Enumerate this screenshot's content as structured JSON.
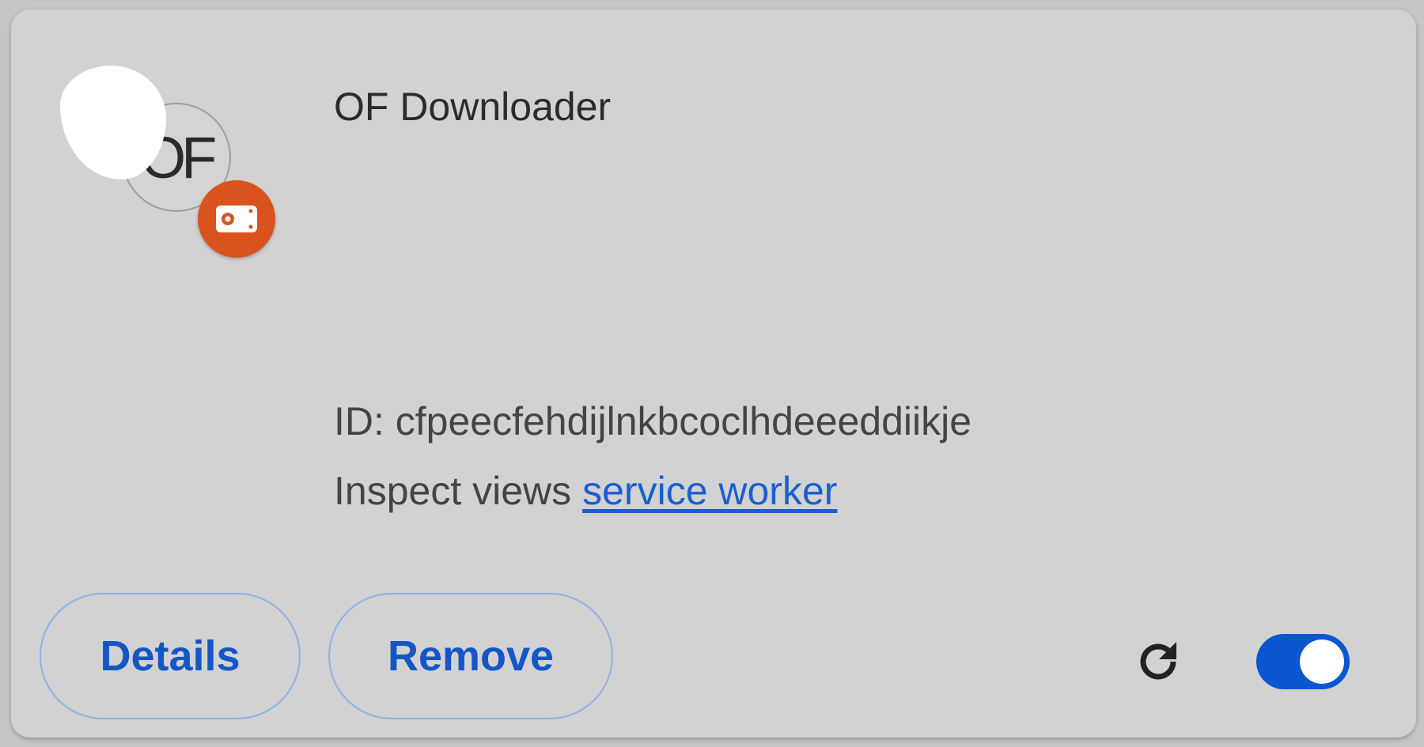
{
  "extension": {
    "logo_text": "OF",
    "name": "OF Downloader",
    "id_line": "ID: cfpeecfehdijlnkbcoclhdeeeddiikje",
    "inspect_label": "Inspect views",
    "inspect_link": "service worker"
  },
  "buttons": {
    "details": "Details",
    "remove": "Remove"
  },
  "toggle": {
    "enabled": true
  },
  "icons": {
    "badge": "camera-badge-icon",
    "reload": "reload-icon"
  },
  "colors": {
    "accent": "#0b57d0",
    "badge": "#d9531e",
    "link": "#1a5fd1"
  }
}
